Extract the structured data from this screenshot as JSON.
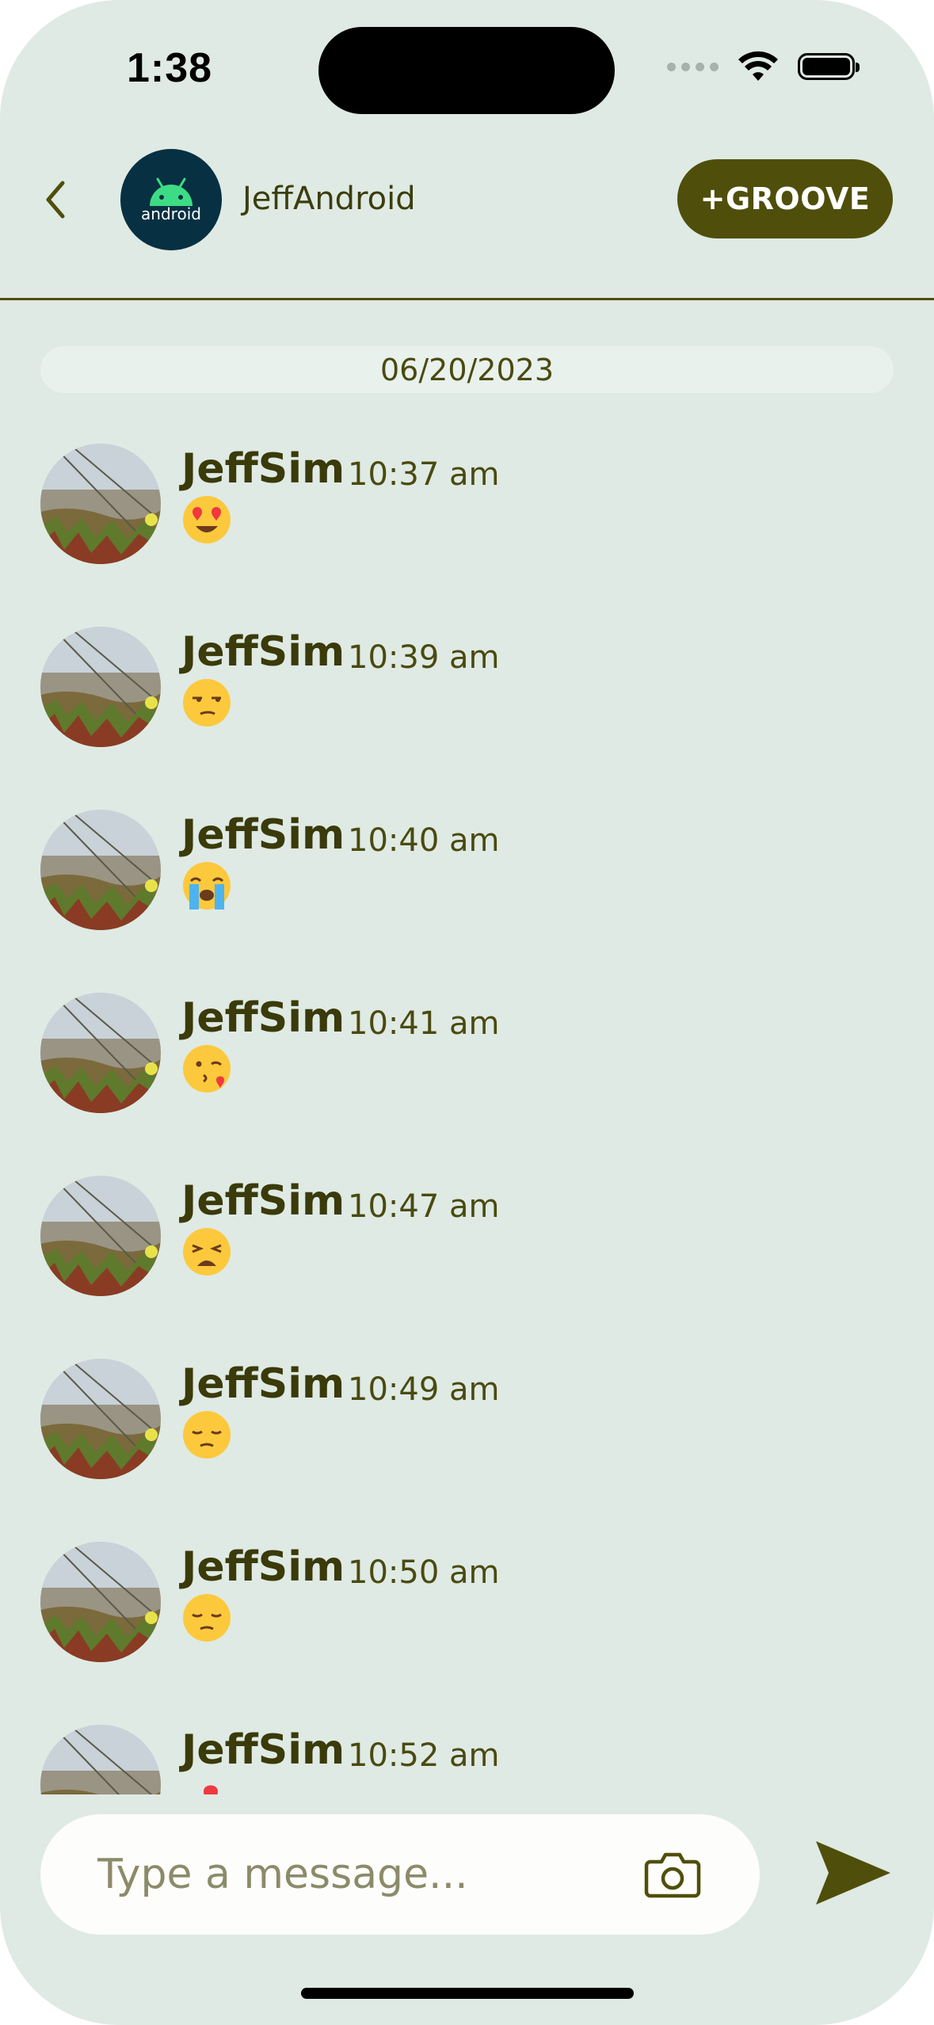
{
  "status_bar": {
    "time": "1:38"
  },
  "header": {
    "avatar_text": "android",
    "contact_name": "JeffAndroid",
    "groove_label": "+GROOVE"
  },
  "date_separator": "06/20/2023",
  "messages": [
    {
      "name": "JeffSim",
      "time": "10:37 am",
      "emoji": "smiling-face-with-heart-eyes"
    },
    {
      "name": "JeffSim",
      "time": "10:39 am",
      "emoji": "unamused-face"
    },
    {
      "name": "JeffSim",
      "time": "10:40 am",
      "emoji": "loudly-crying-face"
    },
    {
      "name": "JeffSim",
      "time": "10:41 am",
      "emoji": "face-blowing-a-kiss"
    },
    {
      "name": "JeffSim",
      "time": "10:47 am",
      "emoji": "weary-face"
    },
    {
      "name": "JeffSim",
      "time": "10:49 am",
      "emoji": "pensive-face"
    },
    {
      "name": "JeffSim",
      "time": "10:50 am",
      "emoji": "pensive-face"
    },
    {
      "name": "JeffSim",
      "time": "10:52 am",
      "emoji": "two-hearts"
    }
  ],
  "composer": {
    "placeholder": "Type a message..."
  },
  "colors": {
    "background": "#dfeae4",
    "accent": "#4f4f0b",
    "text_dark": "#3a3a0a",
    "android_badge": "#073042"
  }
}
